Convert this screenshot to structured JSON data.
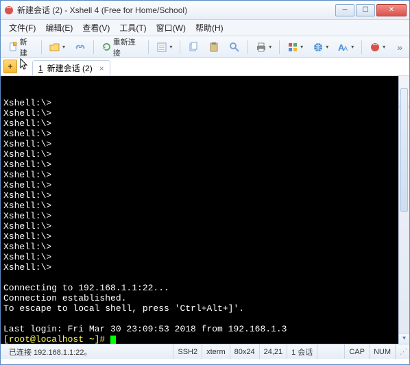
{
  "window": {
    "title": "新建会话 (2) - Xshell 4 (Free for Home/School)"
  },
  "menu": {
    "file": "文件(F)",
    "edit": "编辑(E)",
    "view": "查看(V)",
    "tools": "工具(T)",
    "window": "窗口(W)",
    "help": "帮助(H)"
  },
  "toolbar": {
    "new_label": "新建",
    "reconnect_label": "重新连接"
  },
  "tabs": {
    "active_index": "1",
    "active_label": "新建会话 (2)"
  },
  "terminal": {
    "prompt_lines": [
      "Xshell:\\>",
      "Xshell:\\>",
      "Xshell:\\>",
      "Xshell:\\>",
      "Xshell:\\>",
      "Xshell:\\>",
      "Xshell:\\>",
      "Xshell:\\>",
      "Xshell:\\>",
      "Xshell:\\>",
      "Xshell:\\>",
      "Xshell:\\>",
      "Xshell:\\>",
      "Xshell:\\>",
      "Xshell:\\>",
      "Xshell:\\>",
      "Xshell:\\>"
    ],
    "blank": "",
    "connecting": "Connecting to 192.168.1.1:22...",
    "established": "Connection established.",
    "escape": "To escape to local shell, press 'Ctrl+Alt+]'.",
    "last_login": "Last login: Fri Mar 30 23:09:53 2018 from 192.168.1.3",
    "shell_prompt": "[root@localhost ~]# "
  },
  "status": {
    "connection": "已连接 192.168.1.1:22。",
    "protocol": "SSH2",
    "termtype": "xterm",
    "size": "80x24",
    "cursor": "24,21",
    "sessions": "1 会话",
    "cap": "CAP",
    "num": "NUM"
  }
}
